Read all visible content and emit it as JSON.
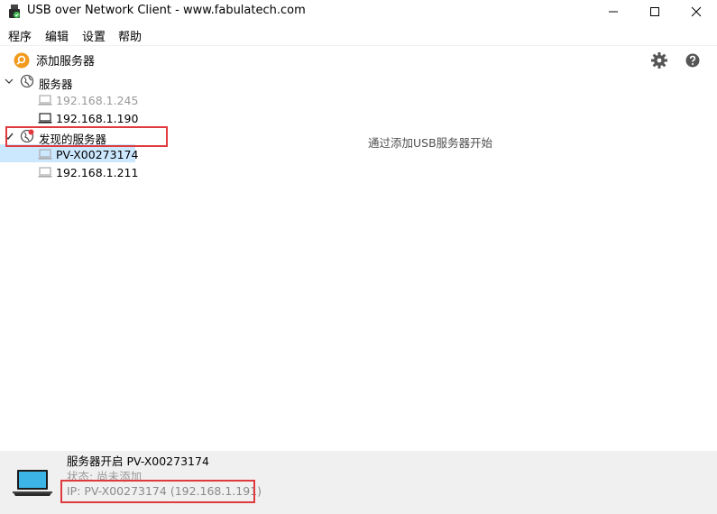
{
  "window": {
    "title": "USB over Network Client - www.fabulatech.com"
  },
  "menu": {
    "items": [
      "程序",
      "编辑",
      "设置",
      "帮助"
    ]
  },
  "toolbar": {
    "add_server_label": "添加服务器"
  },
  "tree": {
    "servers_group": {
      "label": "服务器",
      "items": [
        "192.168.1.245",
        "192.168.1.190"
      ]
    },
    "discovered_group": {
      "label": "发现的服务器",
      "items": [
        "PV-X00273174",
        "192.168.1.211"
      ]
    }
  },
  "main": {
    "hint": "通过添加USB服务器开始"
  },
  "status": {
    "title": "服务器开启 PV-X00273174",
    "state": "状态: 尚未添加",
    "ip": "IP: PV-X00273174 (192.168.1.191)"
  },
  "colors": {
    "selection": "#cce8ff",
    "highlight": "#e0393e",
    "status_bg": "#f0f0f0",
    "accent_orange": "#f29a1e"
  }
}
